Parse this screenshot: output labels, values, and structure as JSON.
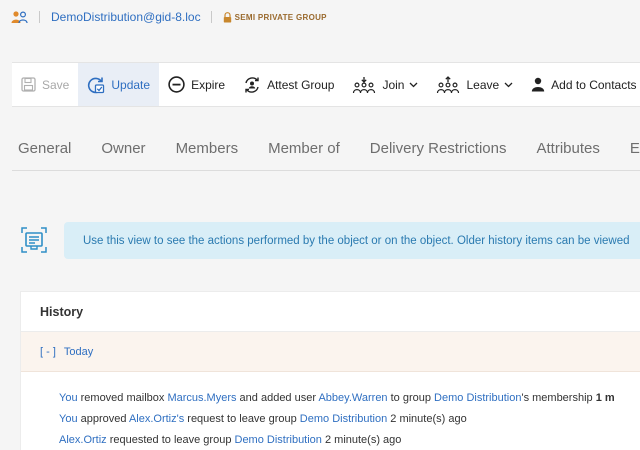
{
  "header": {
    "email": "DemoDistribution@gid-8.loc",
    "group_type": "SEMI PRIVATE GROUP"
  },
  "toolbar": {
    "save": "Save",
    "update": "Update",
    "expire": "Expire",
    "attest": "Attest Group",
    "join": "Join",
    "leave": "Leave",
    "add_contacts": "Add to Contacts"
  },
  "tabs": [
    "General",
    "Owner",
    "Members",
    "Member of",
    "Delivery Restrictions",
    "Attributes",
    "En"
  ],
  "banner": {
    "text": "Use this view to see the actions performed by the object or on the object. Older history items can be viewed"
  },
  "history": {
    "title": "History",
    "toggle": "[ - ]",
    "group_label": "Today",
    "entries": [
      {
        "actor": "You",
        "t1": " removed mailbox ",
        "obj1": "Marcus.Myers",
        "t2": " and added user ",
        "obj2": "Abbey.Warren",
        "t3": " to group ",
        "obj3": "Demo Distribution",
        "t4": "'s membership ",
        "tail": "1 m"
      },
      {
        "actor": "You",
        "t1": " approved ",
        "obj1": "Alex.Ortiz's",
        "t2": " request to leave group ",
        "obj2": "Demo Distribution",
        "t3": " 2 minute(s) ago"
      },
      {
        "actor": "Alex.Ortiz",
        "t1": " requested to leave group ",
        "obj1": "Demo Distribution",
        "t2": " 2 minute(s) ago"
      }
    ]
  },
  "colors": {
    "link": "#2f6fc1",
    "banner_bg": "#d9eef7",
    "banner_text": "#2a7ab0",
    "today_bg": "#fbf4ee",
    "group_type": "#9a6a2e"
  },
  "icons": [
    "group-members-icon",
    "lock-icon",
    "save-icon",
    "update-icon",
    "expire-icon",
    "attest-icon",
    "join-icon",
    "leave-icon",
    "add-contact-icon",
    "info-view-icon",
    "chevron-down-icon"
  ]
}
